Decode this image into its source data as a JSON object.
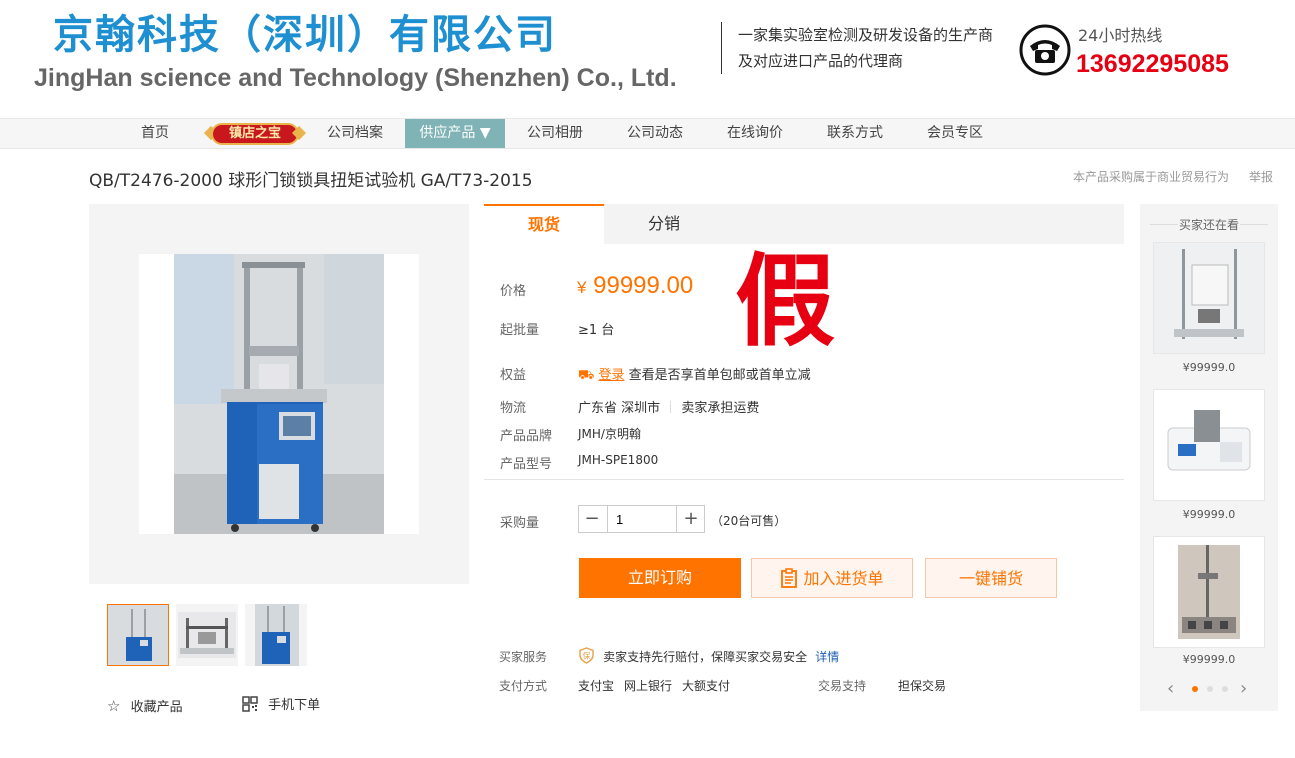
{
  "header": {
    "company_cn": "京翰科技（深圳）有限公司",
    "company_en": "JingHan  science and Technology (Shenzhen) Co., Ltd.",
    "tagline_1": "一家集实验室检测及研发设备的生产商",
    "tagline_2": "及对应进口产品的代理商",
    "hotline_label": "24小时热线",
    "hotline_number": "13692295085"
  },
  "nav": {
    "items": [
      "首页",
      "镇店之宝",
      "公司档案",
      "供应产品 ▼",
      "公司相册",
      "公司动态",
      "在线询价",
      "联系方式",
      "会员专区"
    ],
    "active_index": 3
  },
  "product": {
    "title": "QB/T2476-2000 球形门锁锁具扭矩试验机 GA/T73-2015",
    "trade_note": "本产品采购属于商业贸易行为",
    "report": "举报",
    "fake_mark": "假"
  },
  "tabs": [
    "现货",
    "分销"
  ],
  "details": {
    "price_label": "价格",
    "price_currency": "¥",
    "price_value": "99999.00",
    "moq_label": "起批量",
    "moq_value": "≥1 台",
    "benefit_label": "权益",
    "benefit_login": "登录",
    "benefit_text": "查看是否享首单包邮或首单立减",
    "logistics_label": "物流",
    "logistics_origin": "广东省 深圳市",
    "logistics_fee": "卖家承担运费",
    "brand_label": "产品品牌",
    "brand_value": "JMH/京明翰",
    "model_label": "产品型号",
    "model_value": "JMH-SPE1800",
    "qty_label": "采购量",
    "qty_value": "1",
    "qty_minus": "−",
    "qty_plus": "+",
    "stock_note": "（20台可售）",
    "buy_now": "立即订购",
    "add_cart": "加入进货单",
    "one_click": "一键铺货",
    "service_label": "买家服务",
    "service_text": "卖家支持先行赔付，保障买家交易安全",
    "service_link": "详情",
    "payment_label": "支付方式",
    "payment_options": [
      "支付宝",
      "网上银行",
      "大额支付"
    ],
    "trade_support_label": "交易支持",
    "trade_support_value": "担保交易"
  },
  "gallery": {
    "favorite": "收藏产品",
    "mobile_order": "手机下单"
  },
  "sidebar": {
    "title": "买家还在看",
    "prices": [
      "¥99999.0",
      "¥99999.0",
      "¥99999.0"
    ],
    "prev": "‹",
    "next": "›"
  },
  "colors": {
    "accent": "#ff7300",
    "brand_blue": "#1e8fd0",
    "hotline_red": "#e60012",
    "nav_active": "#7fb3b5"
  }
}
